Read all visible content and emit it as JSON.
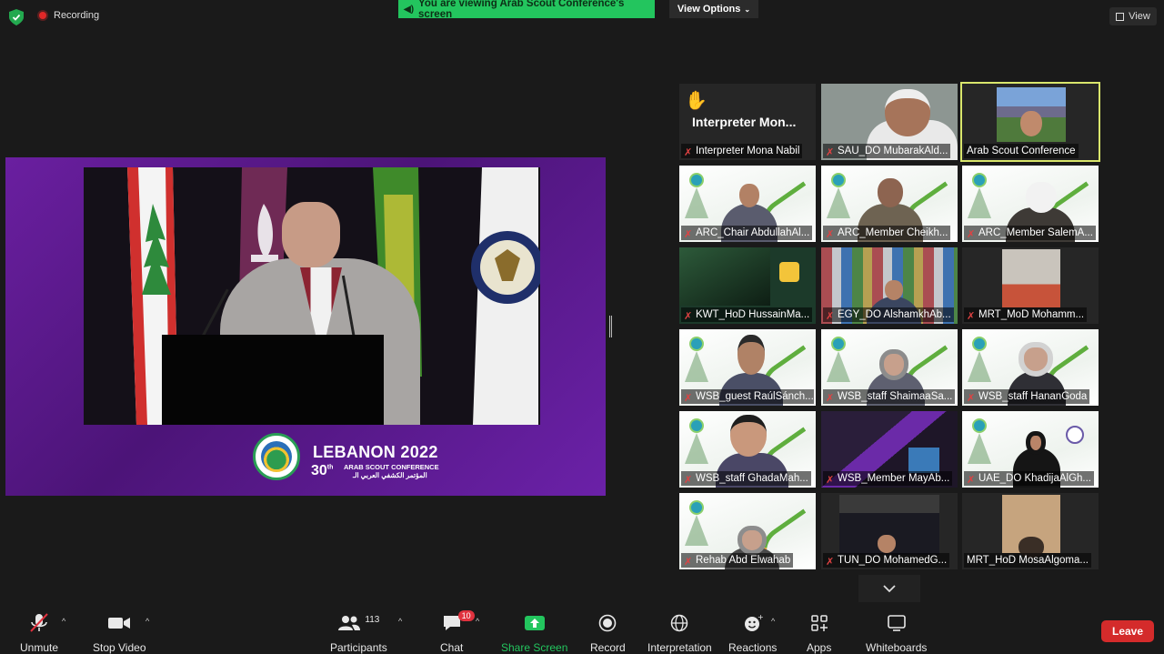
{
  "topbar": {
    "recording_label": "Recording",
    "banner_text": "You are viewing Arab Scout Conference's screen",
    "view_options_label": "View Options",
    "view_label": "View"
  },
  "shared_screen": {
    "event_title": "LEBANON 2022",
    "edition": "30",
    "edition_suffix": "th",
    "subtitle_en": "ARAB SCOUT CONFERENCE",
    "subtitle_ar": "المؤتمر الكشفي العربي الـ"
  },
  "participants_tiles": [
    {
      "name": "Interpreter Mona Nabil",
      "big_name": "Interpreter  Mon...",
      "muted": true
    },
    {
      "name": "SAU_DO MubarakAld...",
      "muted": true
    },
    {
      "name": "Arab Scout Conference",
      "muted": false,
      "active": true
    },
    {
      "name": "ARC_Chair AbdullahAl...",
      "muted": true
    },
    {
      "name": "ARC_Member Cheikh...",
      "muted": true
    },
    {
      "name": "ARC_Member SalemA...",
      "muted": true
    },
    {
      "name": "KWT_HoD HussainMa...",
      "muted": true
    },
    {
      "name": "EGY_DO AlshamkhAb...",
      "muted": true
    },
    {
      "name": "MRT_MoD Mohamm...",
      "muted": true
    },
    {
      "name": "WSB_guest RaúlSánch...",
      "muted": true
    },
    {
      "name": "WSB_staff ShaimaaSa...",
      "muted": true
    },
    {
      "name": "WSB_staff HananGoda",
      "muted": true
    },
    {
      "name": "WSB_staff GhadaMah...",
      "muted": true
    },
    {
      "name": "WSB_Member MayAb...",
      "muted": true
    },
    {
      "name": "UAE_DO KhadijaAlGh...",
      "muted": true
    },
    {
      "name": "Rehab Abd Elwahab",
      "muted": true
    },
    {
      "name": "TUN_DO MohamedG...",
      "muted": true
    },
    {
      "name": "MRT_HoD MosaAlgoma...",
      "muted": false
    }
  ],
  "toolbar": {
    "unmute": "Unmute",
    "stop_video": "Stop Video",
    "participants": "Participants",
    "participants_count": "113",
    "chat": "Chat",
    "chat_badge": "10",
    "share_screen": "Share Screen",
    "record": "Record",
    "interpretation": "Interpretation",
    "reactions": "Reactions",
    "apps": "Apps",
    "whiteboards": "Whiteboards",
    "leave": "Leave"
  },
  "colors": {
    "banner_green": "#23c55e",
    "share_green": "#23c55e",
    "leave_red": "#d42b2b",
    "active_tile_border": "#d9e66c",
    "slide_purple": "#5b1a8c"
  }
}
